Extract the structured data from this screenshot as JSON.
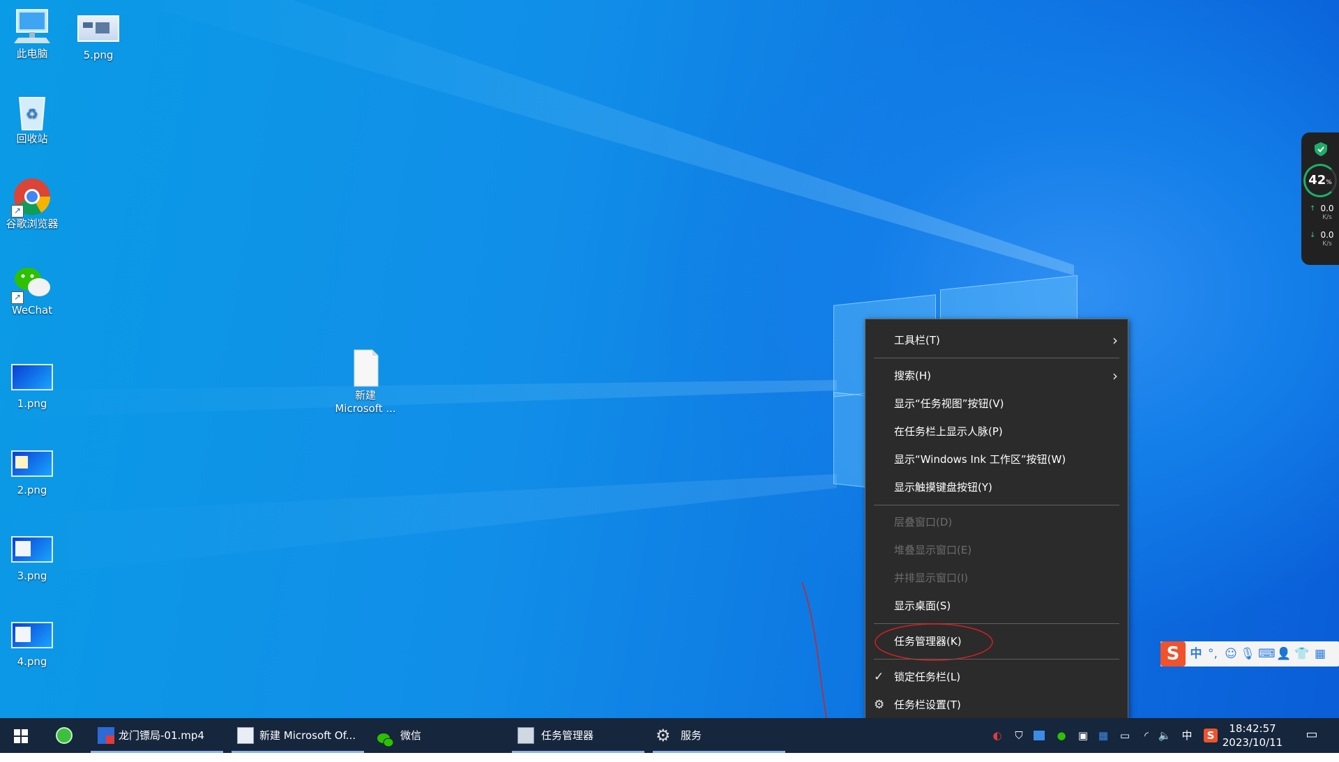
{
  "desktop": {
    "icons": [
      {
        "label": "此电脑",
        "icon": "computer-icon"
      },
      {
        "label": "5.png",
        "icon": "image-file-icon"
      },
      {
        "label": "回收站",
        "icon": "recycle-bin-icon"
      },
      {
        "label": "谷歌浏览器",
        "icon": "chrome-icon"
      },
      {
        "label": "WeChat",
        "icon": "wechat-icon"
      },
      {
        "label": "1.png",
        "icon": "image-file-icon"
      },
      {
        "label": "2.png",
        "icon": "image-file-icon"
      },
      {
        "label": "3.png",
        "icon": "image-file-icon"
      },
      {
        "label": "4.png",
        "icon": "image-file-icon"
      },
      {
        "label_line1": "新建",
        "label_line2": "Microsoft ...",
        "icon": "document-icon"
      }
    ]
  },
  "context_menu": {
    "items": [
      {
        "label": "工具栏(T)",
        "submenu": true,
        "enabled": true
      },
      {
        "label": "搜索(H)",
        "submenu": true,
        "enabled": true
      },
      {
        "label": "显示“任务视图”按钮(V)",
        "enabled": true
      },
      {
        "label": "在任务栏上显示人脉(P)",
        "enabled": true
      },
      {
        "label": "显示“Windows Ink 工作区”按钮(W)",
        "enabled": true
      },
      {
        "label": "显示触摸键盘按钮(Y)",
        "enabled": true
      },
      {
        "label": "层叠窗口(D)",
        "enabled": false
      },
      {
        "label": "堆叠显示窗口(E)",
        "enabled": false
      },
      {
        "label": "并排显示窗口(I)",
        "enabled": false
      },
      {
        "label": "显示桌面(S)",
        "enabled": true
      },
      {
        "label": "任务管理器(K)",
        "enabled": true,
        "annotated": "red-circle"
      },
      {
        "label": "锁定任务栏(L)",
        "enabled": true,
        "checked": true
      },
      {
        "label": "任务栏设置(T)",
        "enabled": true,
        "icon": "gear-icon"
      }
    ],
    "submenu_arrow": "chevron-right-icon"
  },
  "taskbar": {
    "start_icon": "windows-start-icon",
    "pinned": [
      {
        "icon": "360-browser-icon"
      },
      {
        "label": "龙门镖局-01.mp4",
        "icon": "video-player-icon"
      },
      {
        "label": "新建 Microsoft Of...",
        "icon": "word-document-icon"
      },
      {
        "label": "微信",
        "icon": "wechat-icon"
      },
      {
        "label": "任务管理器",
        "icon": "task-manager-icon"
      },
      {
        "label": "服务",
        "icon": "services-gear-icon"
      }
    ],
    "tray": {
      "ime_indicator": "中",
      "time": "18:42:57",
      "date": "2023/10/11"
    }
  },
  "side_widget": {
    "percent": "42",
    "percent_unit": "%",
    "upload": "0.0",
    "upload_unit": "K/s",
    "download": "0.0",
    "download_unit": "K/s"
  },
  "ime_bar": {
    "mode": "中",
    "punct": "°,"
  },
  "colors": {
    "desktop_blue": "#118ee8",
    "menu_bg": "#2b2b2b",
    "taskbar_bg": "#16263d",
    "annotation_red": "#d42020"
  }
}
